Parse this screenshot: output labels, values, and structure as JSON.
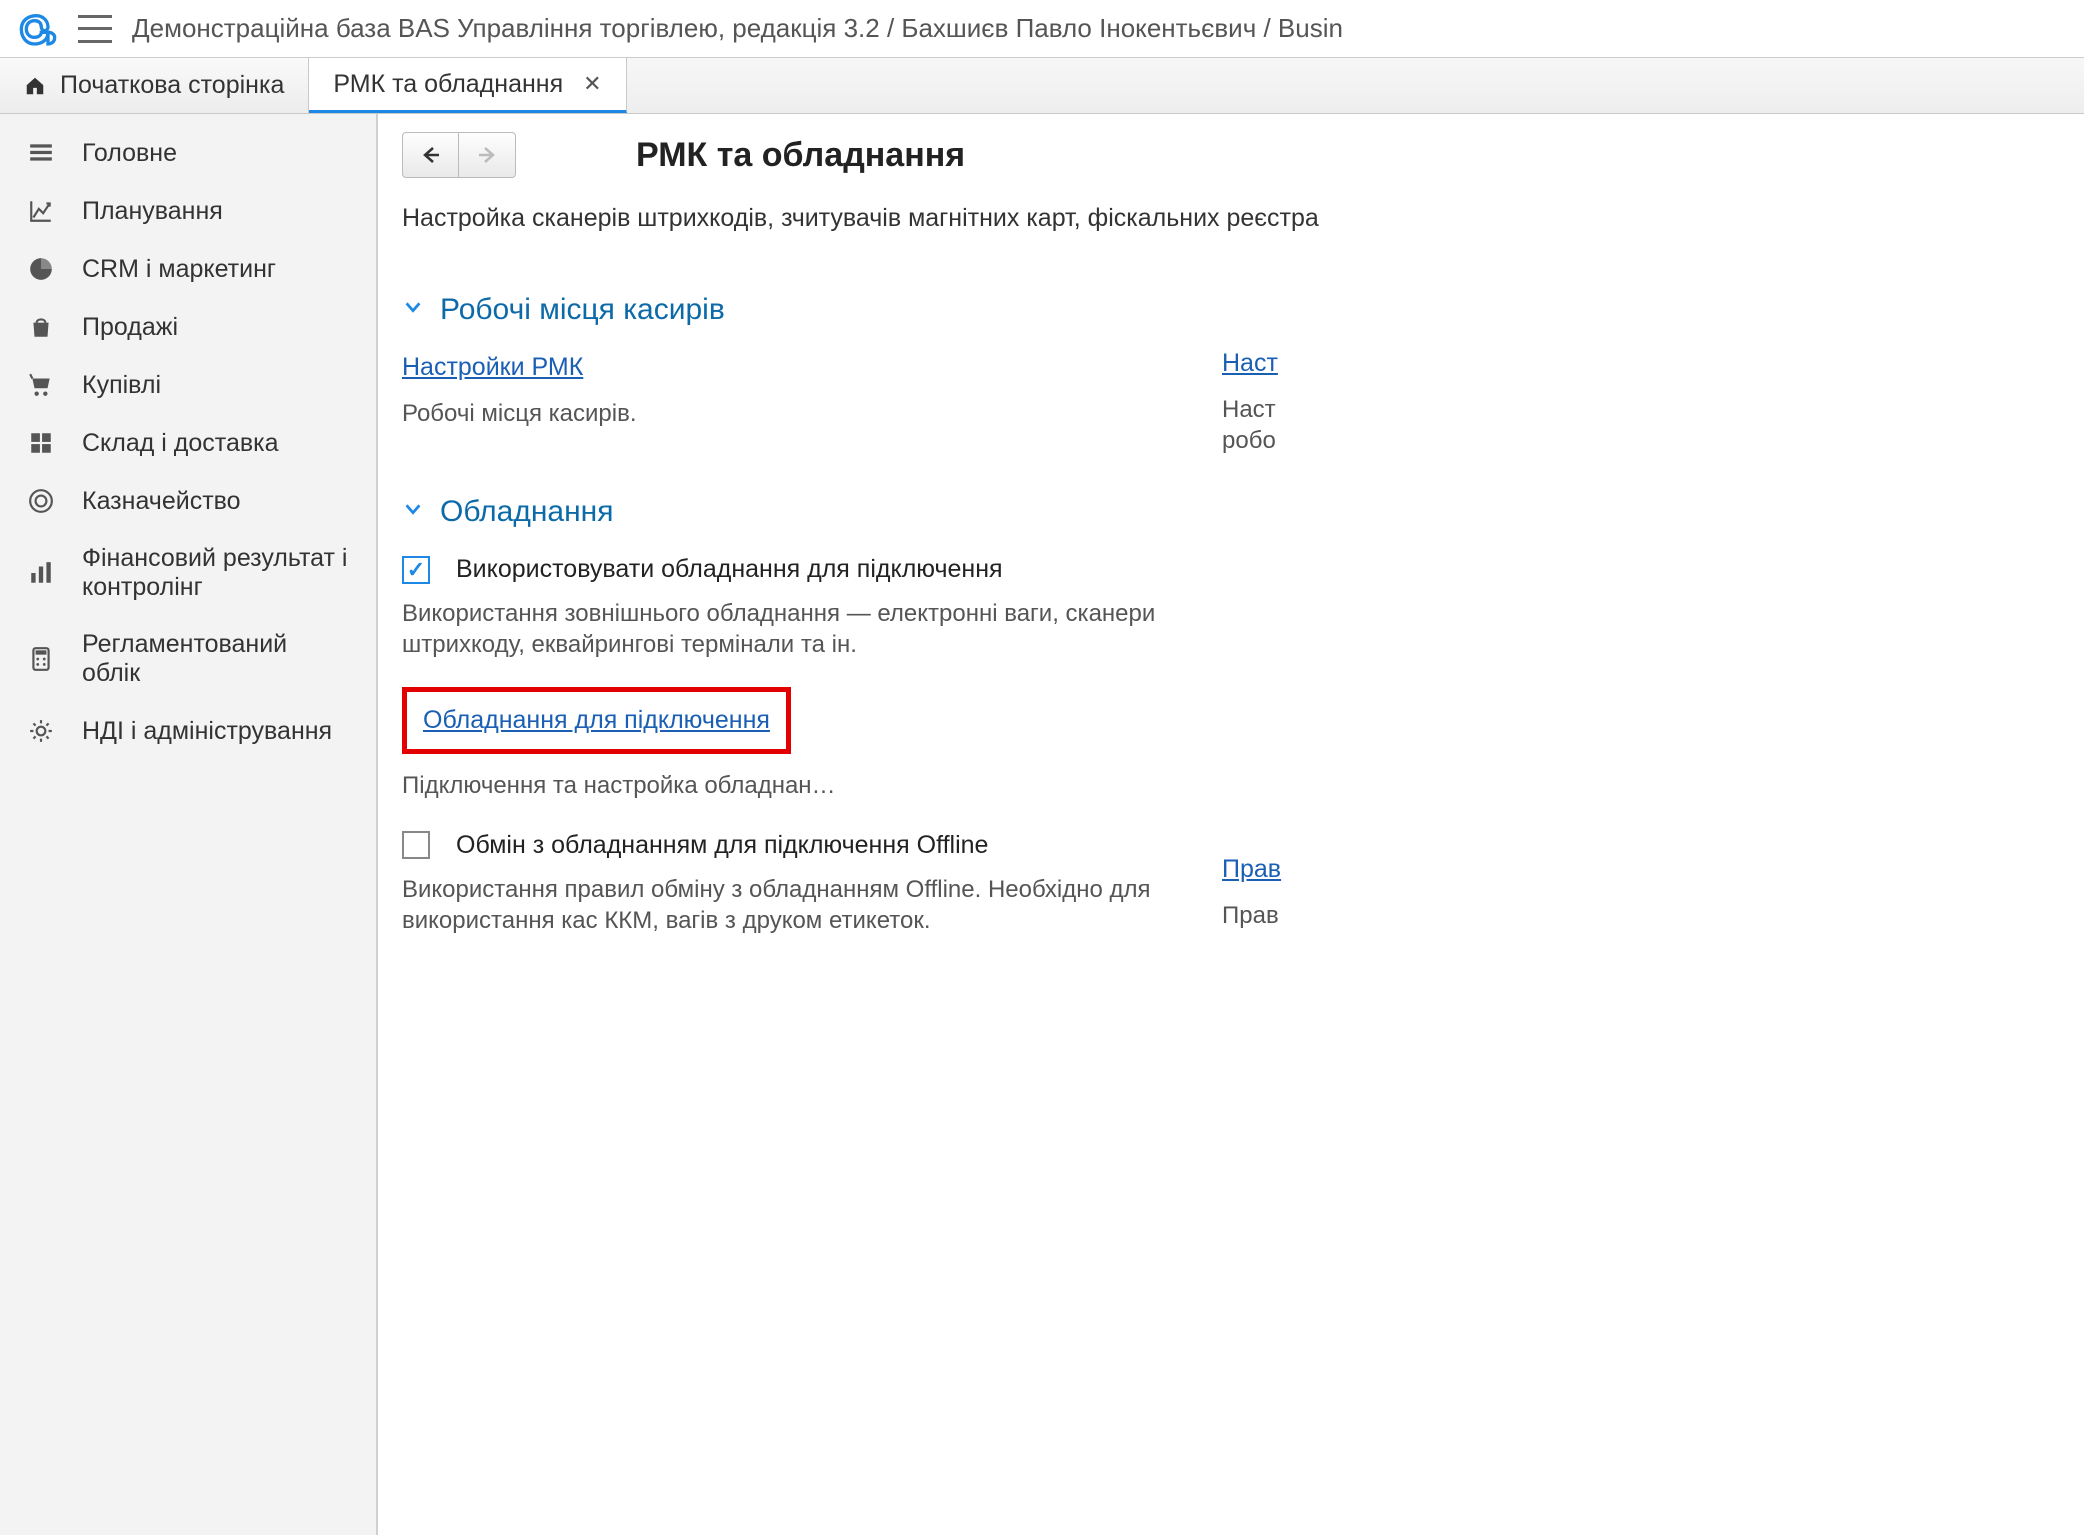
{
  "app_title": "Демонстраційна база BAS Управління торгівлею, редакція 3.2 / Бахшиєв Павло Інокентьєвич / Busin",
  "tabs": [
    {
      "label": "Початкова сторінка"
    },
    {
      "label": "РМК та обладнання"
    }
  ],
  "sidebar": [
    {
      "label": "Головне",
      "icon": "menu"
    },
    {
      "label": "Планування",
      "icon": "chart-line"
    },
    {
      "label": "CRM і маркетинг",
      "icon": "pie"
    },
    {
      "label": "Продажі",
      "icon": "bag"
    },
    {
      "label": "Купівлі",
      "icon": "cart"
    },
    {
      "label": "Склад і доставка",
      "icon": "grid"
    },
    {
      "label": "Казначейство",
      "icon": "coin"
    },
    {
      "label": "Фінансовий результат і контролінг",
      "icon": "bars"
    },
    {
      "label": "Регламентований облік",
      "icon": "calc"
    },
    {
      "label": "НДІ і адміністрування",
      "icon": "gear"
    }
  ],
  "page": {
    "title": "РМК та обладнання",
    "subtitle": "Настройка сканерів штрихкодів, зчитувачів магнітних карт, фіскальних реєстра"
  },
  "section_cashier": {
    "title": "Робочі місця касирів",
    "link": "Настройки РМК",
    "desc": "Робочі місця касирів.",
    "right_link": "Наст",
    "right_desc1": "Наст",
    "right_desc2": "робо"
  },
  "section_equipment": {
    "title": "Обладнання",
    "check_use_label": "Використовувати обладнання для підключення",
    "use_desc": "Використання зовнішнього обладнання — електронні ваги, сканери штрихкоду, еквайрингові термінали та ін.",
    "link_connect": "Обладнання для підключення",
    "connect_desc": "Підключення та настройка обладнан…",
    "check_offline_label": "Обмін з обладнанням для підключення Offline",
    "offline_desc": "Використання правил обміну з обладнанням Offline. Необхідно для використання кас ККМ, вагів з друком етикеток.",
    "right_link": "Прав",
    "right_desc": "Прав"
  }
}
